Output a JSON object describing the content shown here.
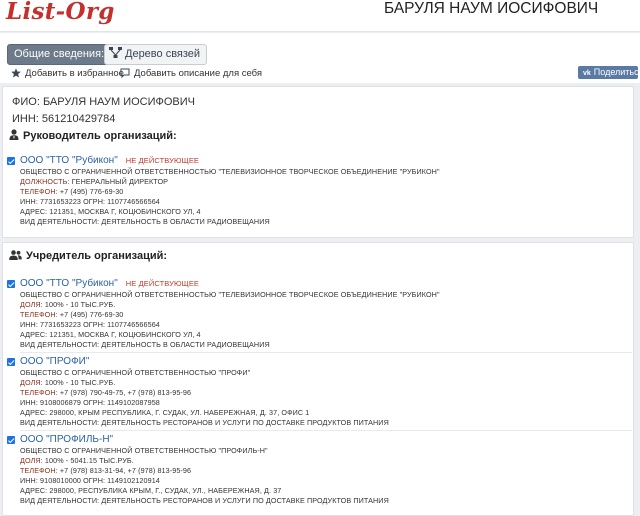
{
  "header": {
    "logo": "List-Org",
    "title": "БАРУЛЯ НАУМ ИОСИФОВИЧ"
  },
  "tabs": [
    {
      "label": "Общие сведения:",
      "active": true
    },
    {
      "label": "Дерево связей",
      "active": false
    }
  ],
  "actions": {
    "favorite": "Добавить в избранное",
    "add_description": "Добавить описание для себя",
    "share": "Поделиться"
  },
  "person": {
    "fio": "ФИО: БАРУЛЯ НАУМ ИОСИФОВИЧ",
    "inn": "ИНН: 561210429784"
  },
  "sections": {
    "head_title": "Руководитель организаций:",
    "founder_title": "Учредитель организаций:"
  },
  "head_orgs": [
    {
      "name": "ООО \"ТТО \"Рубикон\"",
      "status": "НЕ ДЕЙСТВУЮЩЕЕ",
      "full_name": "ОБЩЕСТВО С ОГРАНИЧЕННОЙ ОТВЕТСТВЕННОСТЬЮ \"ТЕЛЕВИЗИОННОЕ ТВОРЧЕСКОЕ ОБЪЕДИНЕНИЕ \"РУБИКОН\"",
      "lines": [
        {
          "label": "ДОЛЖНОСТЬ:",
          "value": "ГЕНЕРАЛЬНЫЙ ДИРЕКТОР"
        },
        {
          "label": "ТЕЛЕФОН:",
          "value": "+7 (495) 776-69-30"
        },
        {
          "label": "",
          "value": "ИНН: 7731653223 ОГРН: 1107746566564"
        },
        {
          "label": "",
          "value": "АДРЕС: 121351, МОСКВА Г, КОЦЮБИНСКОГО УЛ, 4"
        },
        {
          "label": "",
          "value": "ВИД ДЕЯТЕЛЬНОСТИ: ДЕЯТЕЛЬНОСТЬ В ОБЛАСТИ РАДИОВЕЩАНИЯ"
        }
      ]
    }
  ],
  "founder_orgs": [
    {
      "name": "ООО \"ТТО \"Рубикон\"",
      "status": "НЕ ДЕЙСТВУЮЩЕЕ",
      "full_name": "ОБЩЕСТВО С ОГРАНИЧЕННОЙ ОТВЕТСТВЕННОСТЬЮ \"ТЕЛЕВИЗИОННОЕ ТВОРЧЕСКОЕ ОБЪЕДИНЕНИЕ \"РУБИКОН\"",
      "lines": [
        {
          "label": "ДОЛЯ:",
          "value": "100% - 10 ТЫС.РУБ."
        },
        {
          "label": "ТЕЛЕФОН:",
          "value": "+7 (495) 776-69-30"
        },
        {
          "label": "",
          "value": "ИНН: 7731653223 ОГРН: 1107746566564"
        },
        {
          "label": "",
          "value": "АДРЕС: 121351, МОСКВА Г, КОЦЮБИНСКОГО УЛ, 4"
        },
        {
          "label": "",
          "value": "ВИД ДЕЯТЕЛЬНОСТИ: ДЕЯТЕЛЬНОСТЬ В ОБЛАСТИ РАДИОВЕЩАНИЯ"
        }
      ]
    },
    {
      "name": "ООО \"ПРОФИ\"",
      "status": "",
      "full_name": "ОБЩЕСТВО С ОГРАНИЧЕННОЙ ОТВЕТСТВЕННОСТЬЮ \"ПРОФИ\"",
      "lines": [
        {
          "label": "ДОЛЯ:",
          "value": "100% - 10 ТЫС.РУБ."
        },
        {
          "label": "ТЕЛЕФОН:",
          "value": "+7 (978) 790-49-75, +7 (978) 813-95-96"
        },
        {
          "label": "",
          "value": "ИНН: 9108006879 ОГРН: 1149102087958"
        },
        {
          "label": "",
          "value": "АДРЕС: 298000, КРЫМ РЕСПУБЛИКА, Г. СУДАК, УЛ. НАБЕРЕЖНАЯ, Д. 37, ОФИС 1"
        },
        {
          "label": "",
          "value": "ВИД ДЕЯТЕЛЬНОСТИ: ДЕЯТЕЛЬНОСТЬ РЕСТОРАНОВ И УСЛУГИ ПО ДОСТАВКЕ ПРОДУКТОВ ПИТАНИЯ"
        }
      ]
    },
    {
      "name": "ООО \"ПРОФИЛЬ-Н\"",
      "status": "",
      "full_name": "ОБЩЕСТВО С ОГРАНИЧЕННОЙ ОТВЕТСТВЕННОСТЬЮ \"ПРОФИЛЬ-Н\"",
      "lines": [
        {
          "label": "ДОЛЯ:",
          "value": "100% - 5041.15 ТЫС.РУБ."
        },
        {
          "label": "ТЕЛЕФОН:",
          "value": "+7 (978) 813-31-94, +7 (978) 813-95-96"
        },
        {
          "label": "",
          "value": "ИНН: 9108010000 ОГРН: 1149102120914"
        },
        {
          "label": "",
          "value": "АДРЕС: 298000, РЕСПУБЛИКА КРЫМ, Г., СУДАК, УЛ., НАБЕРЕЖНАЯ, Д. 37"
        },
        {
          "label": "",
          "value": "ВИД ДЕЯТЕЛЬНОСТИ: ДЕЯТЕЛЬНОСТЬ РЕСТОРАНОВ И УСЛУГИ ПО ДОСТАВКЕ ПРОДУКТОВ ПИТАНИЯ"
        }
      ]
    }
  ],
  "colors": {
    "logo": "#c6302c",
    "link": "#2b62a8",
    "status": "#c0392b",
    "tab_active": "#6c7a8a",
    "share": "#5a7aa3"
  }
}
